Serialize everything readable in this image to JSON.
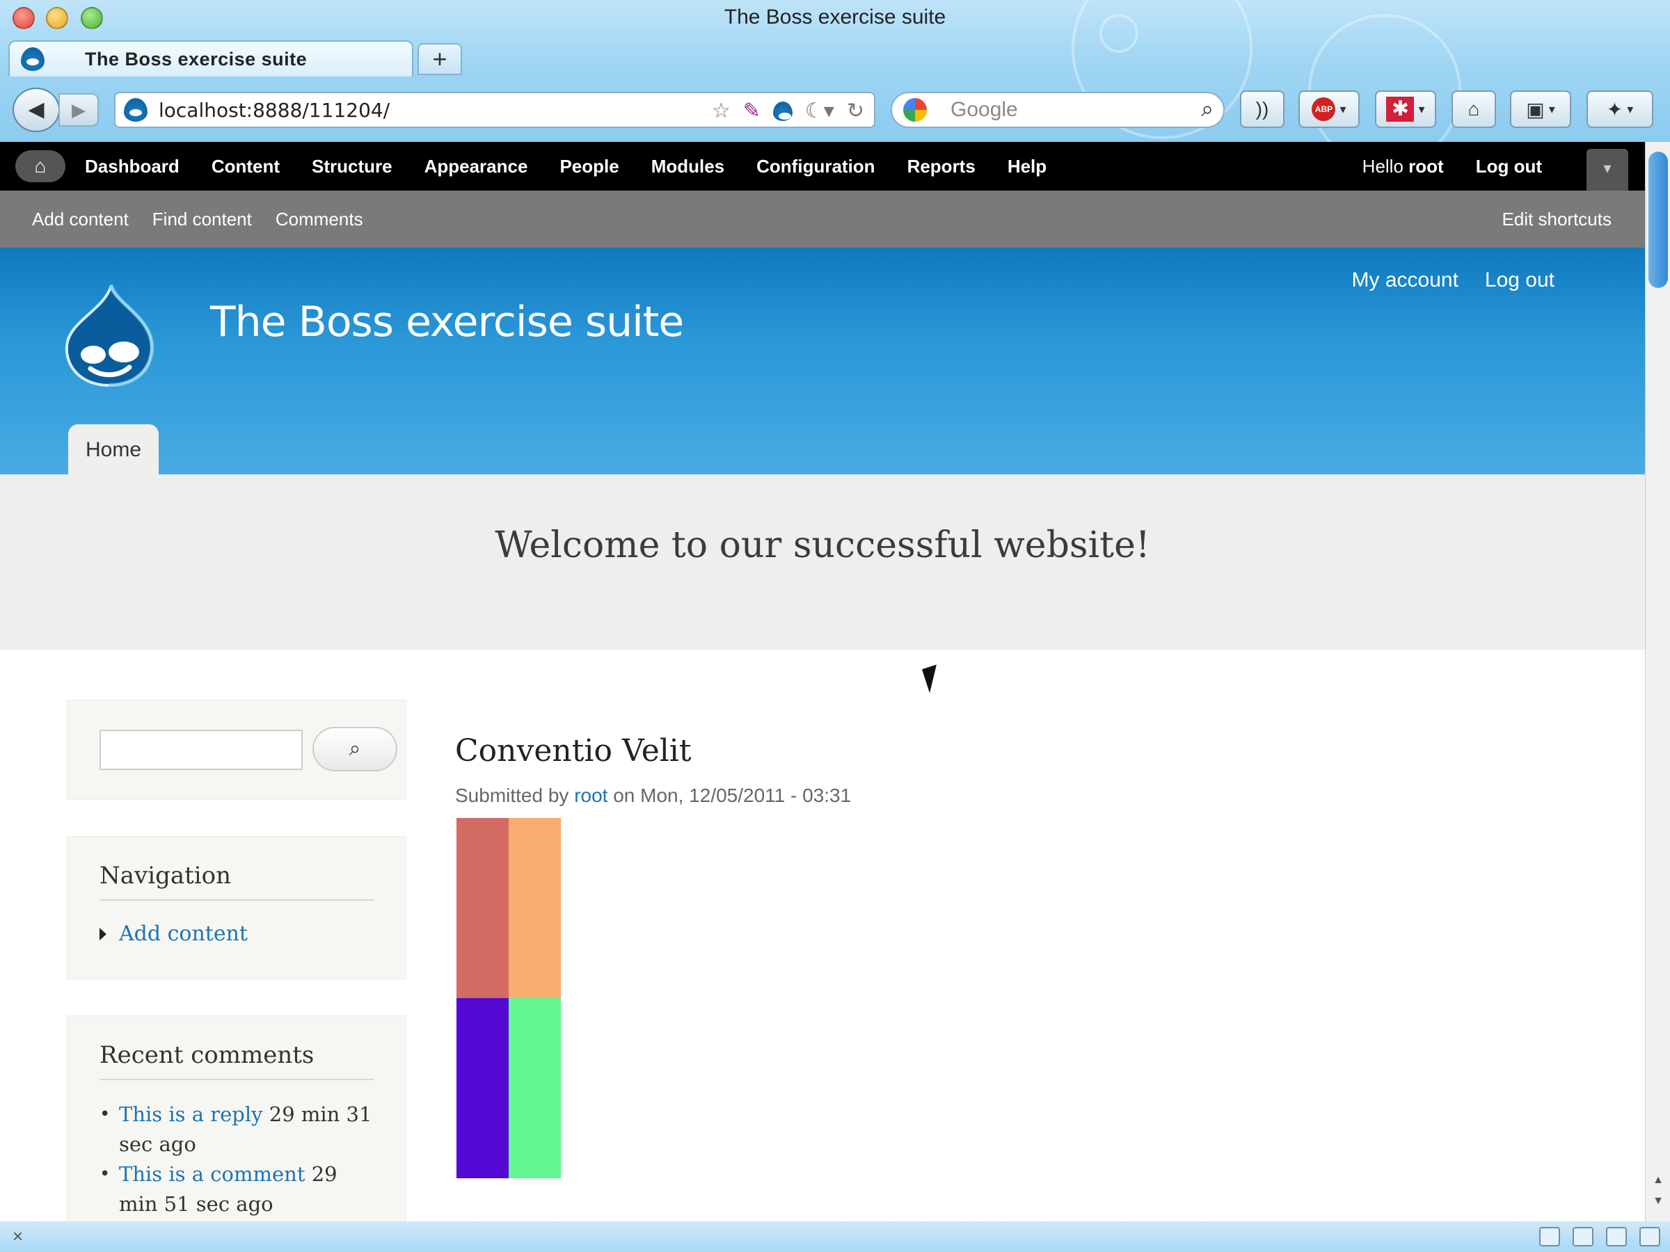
{
  "browser": {
    "window_title": "The Boss exercise suite",
    "tab_title": "The Boss exercise suite",
    "new_tab_label": "+",
    "url": "localhost:8888/111204/",
    "search_placeholder": "Google"
  },
  "admin_toolbar": {
    "items": [
      "Dashboard",
      "Content",
      "Structure",
      "Appearance",
      "People",
      "Modules",
      "Configuration",
      "Reports",
      "Help"
    ],
    "hello_prefix": "Hello ",
    "hello_user": "root",
    "logout": "Log out"
  },
  "shortcuts": {
    "items": [
      "Add content",
      "Find content",
      "Comments"
    ],
    "edit": "Edit shortcuts"
  },
  "header": {
    "site_name": "The Boss exercise suite",
    "secondary_menu": [
      "My account",
      "Log out"
    ],
    "main_menu_home": "Home"
  },
  "featured": {
    "text": "Welcome to our successful website!"
  },
  "sidebar": {
    "navigation_title": "Navigation",
    "navigation_items": [
      "Add content"
    ],
    "recent_comments_title": "Recent comments",
    "recent_comments": [
      {
        "link": "This is a reply",
        "time": " 29 min 31 sec ago"
      },
      {
        "link": "This is a comment",
        "time": " 29 min 51 sec ago"
      }
    ]
  },
  "node": {
    "title": "Conventio Velit",
    "submitted_prefix": "Submitted by ",
    "author": "root",
    "submitted_suffix": " on Mon, 12/05/2011 - 03:31",
    "image_colors": [
      "#d36b63",
      "#f9ad71",
      "#5408d4",
      "#63f78f"
    ]
  },
  "colors": {
    "header_blue": "#2a97d7",
    "link_blue": "#1c73b6",
    "admin_bar": "#000000",
    "shortcut_bar": "#7a7a7a"
  }
}
